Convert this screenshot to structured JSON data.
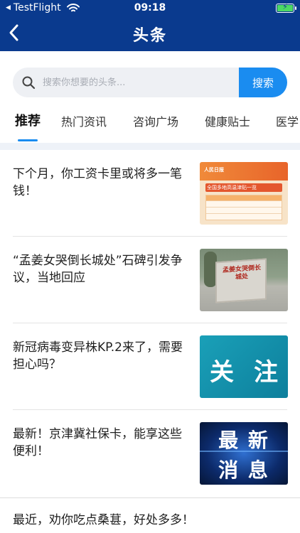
{
  "status_bar": {
    "carrier": "TestFlight",
    "time": "09:18"
  },
  "nav": {
    "title": "头条"
  },
  "search": {
    "placeholder": "搜索你想要的头条...",
    "button_label": "搜索"
  },
  "tabs": [
    {
      "label": "推荐",
      "active": true
    },
    {
      "label": "热门资讯",
      "active": false
    },
    {
      "label": "咨询广场",
      "active": false
    },
    {
      "label": "健康贴士",
      "active": false
    },
    {
      "label": "医学",
      "active": false
    }
  ],
  "news": [
    {
      "title": "下个月，你工资卡里或将多一笔钱！",
      "thumb_logo": "人民日报",
      "thumb_banner": "全国多地高温津贴一览"
    },
    {
      "title": "“孟姜女哭倒长城处”石碑引发争议，当地回应",
      "thumb_text": "孟姜女哭倒长城处"
    },
    {
      "title": "新冠病毒变异株KP.2来了，需要担心吗？",
      "thumb_text_1": "关",
      "thumb_text_2": "注"
    },
    {
      "title": "最新！京津冀社保卡，能享这些便利！",
      "thumb_line_1": "最 新",
      "thumb_line_2": "消 息"
    },
    {
      "title": "最近，劝你吃点桑葚，好处多多！"
    }
  ],
  "colors": {
    "header": "#0a3a8e",
    "accent": "#1a8cf0",
    "battery": "#4cd964"
  }
}
